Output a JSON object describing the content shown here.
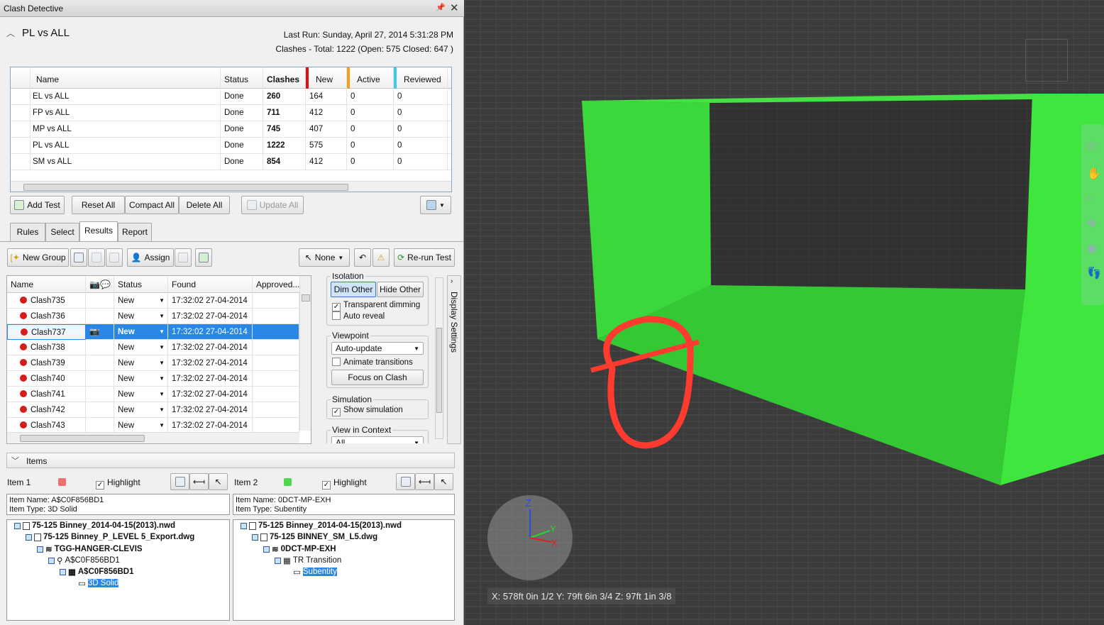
{
  "window": {
    "title": "Clash Detective"
  },
  "test": {
    "name": "PL vs ALL",
    "last_run": "Last Run:  Sunday, April 27, 2014 5:31:28 PM",
    "summary": "Clashes - Total: 1222  (Open:  575  Closed:  647 )"
  },
  "tests_table": {
    "headers": [
      "Name",
      "Status",
      "Clashes",
      "New",
      "Active",
      "Reviewed"
    ],
    "rows": [
      {
        "name": "EL vs ALL",
        "status": "Done",
        "clashes": "260",
        "new": "164",
        "active": "0",
        "reviewed": "0",
        "extra": "0"
      },
      {
        "name": "FP vs ALL",
        "status": "Done",
        "clashes": "711",
        "new": "412",
        "active": "0",
        "reviewed": "0",
        "extra": "0"
      },
      {
        "name": "MP vs ALL",
        "status": "Done",
        "clashes": "745",
        "new": "407",
        "active": "0",
        "reviewed": "0",
        "extra": "0"
      },
      {
        "name": "PL vs ALL",
        "status": "Done",
        "clashes": "1222",
        "new": "575",
        "active": "0",
        "reviewed": "0",
        "extra": "0"
      },
      {
        "name": "SM vs ALL",
        "status": "Done",
        "clashes": "854",
        "new": "412",
        "active": "0",
        "reviewed": "0",
        "extra": "0"
      }
    ]
  },
  "toolbar": {
    "add_test": "Add Test",
    "reset_all": "Reset All",
    "compact_all": "Compact All",
    "delete_all": "Delete All",
    "update_all": "Update All"
  },
  "tabs": [
    "Rules",
    "Select",
    "Results",
    "Report"
  ],
  "results_toolbar": {
    "new_group": "New Group",
    "assign": "Assign",
    "none": "None",
    "rerun": "Re-run Test"
  },
  "results_table": {
    "headers": [
      "Name",
      "Status",
      "Found",
      "Approved..."
    ],
    "rows": [
      {
        "name": "Clash735",
        "status": "New",
        "found": "17:32:02 27-04-2014"
      },
      {
        "name": "Clash736",
        "status": "New",
        "found": "17:32:02 27-04-2014"
      },
      {
        "name": "Clash737",
        "status": "New",
        "found": "17:32:02 27-04-2014"
      },
      {
        "name": "Clash738",
        "status": "New",
        "found": "17:32:02 27-04-2014"
      },
      {
        "name": "Clash739",
        "status": "New",
        "found": "17:32:02 27-04-2014"
      },
      {
        "name": "Clash740",
        "status": "New",
        "found": "17:32:02 27-04-2014"
      },
      {
        "name": "Clash741",
        "status": "New",
        "found": "17:32:02 27-04-2014"
      },
      {
        "name": "Clash742",
        "status": "New",
        "found": "17:32:02 27-04-2014"
      },
      {
        "name": "Clash743",
        "status": "New",
        "found": "17:32:02 27-04-2014"
      }
    ]
  },
  "display_settings": {
    "side_label": "Display Settings",
    "isolation_label": "Isolation",
    "dim_other": "Dim Other",
    "hide_other": "Hide Other",
    "transparent_dimming": "Transparent dimming",
    "auto_reveal": "Auto reveal",
    "viewpoint_label": "Viewpoint",
    "viewpoint_value": "Auto-update",
    "animate_transitions": "Animate transitions",
    "focus_on_clash": "Focus on Clash",
    "simulation_label": "Simulation",
    "show_simulation": "Show simulation",
    "view_in_context_label": "View in Context",
    "view_in_context_value": "All"
  },
  "items": {
    "header": "Items",
    "item1": {
      "label": "Item 1",
      "highlight": "Highlight",
      "color": "#f07070",
      "name": "Item Name: A$C0F856BD1",
      "type": "Item Type: 3D Solid",
      "tree": [
        "75-125 Binney_2014-04-15(2013).nwd",
        "75-125 Binney_P_LEVEL 5_Export.dwg",
        "TGG-HANGER-CLEVIS",
        "A$C0F856BD1",
        "A$C0F856BD1",
        "3D Solid"
      ]
    },
    "item2": {
      "label": "Item 2",
      "highlight": "Highlight",
      "color": "#4ed84e",
      "name": "Item Name: 0DCT-MP-EXH",
      "type": "Item Type: Subentity",
      "tree": [
        "75-125 Binney_2014-04-15(2013).nwd",
        "75-125 BINNEY_SM_L5.dwg",
        "0DCT-MP-EXH",
        "TR Transition",
        "Subentity"
      ]
    }
  },
  "viewport": {
    "coords": "X: 578ft 0in 1/2  Y: 79ft 6in 3/4  Z: 97ft 1in 3/8",
    "axis_z": "Z",
    "axis_y": "Y",
    "axis_x": "X"
  },
  "colors": {
    "clash_red": "#ff3b30",
    "duct_green": "#3ce03c",
    "selection": "#2b87e5"
  }
}
